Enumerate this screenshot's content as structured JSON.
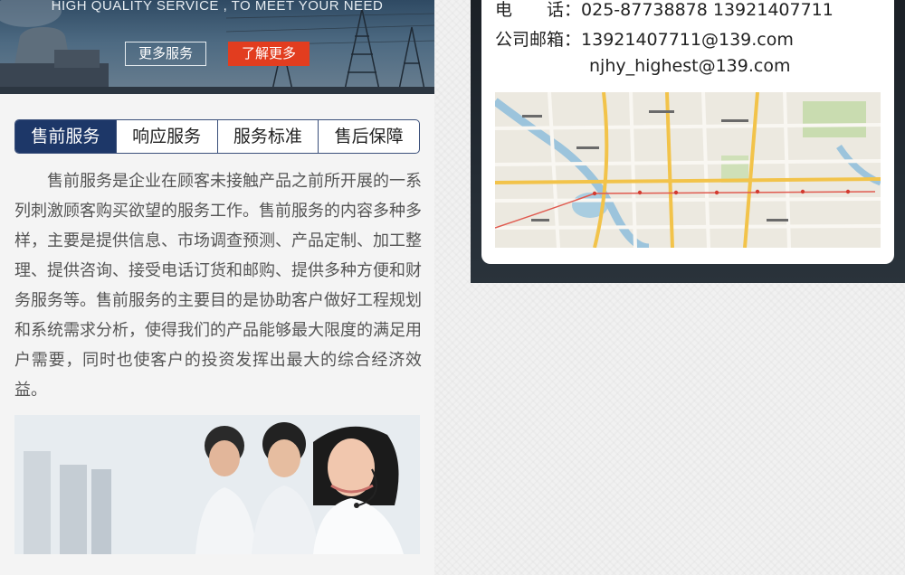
{
  "banner": {
    "tagline": "HIGH QUALITY SERVICE , TO MEET YOUR NEED",
    "more_services_label": "更多服务",
    "learn_more_label": "了解更多"
  },
  "service_tabs": {
    "items": [
      {
        "label": "售前服务",
        "active": true
      },
      {
        "label": "响应服务",
        "active": false
      },
      {
        "label": "服务标准",
        "active": false
      },
      {
        "label": "售后保障",
        "active": false
      }
    ],
    "content": "售前服务是企业在顾客未接触产品之前所开展的一系列刺激顾客购买欲望的服务工作。售前服务的内容多种多样，主要是提供信息、市场调查预测、产品定制、加工整理、提供咨询、接受电话订货和邮购、提供多种方便和财务服务等。售前服务的主要目的是协助客户做好工程规划和系统需求分析，使得我们的产品能够最大限度的满足用户需要，同时也使客户的投资发挥出最大的综合经济效益。"
  },
  "contact": {
    "phone_label": "电　　话：",
    "phone_values": "025-87738878   13921407711",
    "email_label": "公司邮箱：",
    "email_1": "13921407711@139.com",
    "email_2": "njhy_highest@139.com"
  },
  "colors": {
    "tab_active_bg": "#1d3768",
    "learn_more_bg": "#e23d1f"
  }
}
